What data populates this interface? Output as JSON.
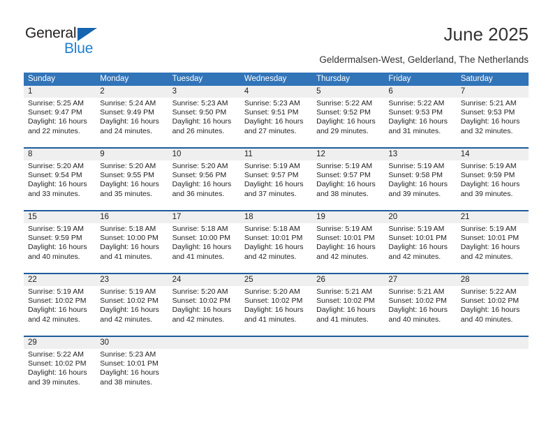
{
  "brand": {
    "name_top": "General",
    "name_bottom": "Blue",
    "triangle_color": "#1565b0",
    "blue_color": "#1f7fd4"
  },
  "header": {
    "title": "June 2025",
    "subtitle": "Geldermalsen-West, Gelderland, The Netherlands"
  },
  "colors": {
    "header_row_bg": "#3174b8",
    "week_divider": "#1d5c9e",
    "daynum_band_bg": "#efefef",
    "text": "#222222"
  },
  "calendar": {
    "weekday_headers": [
      "Sunday",
      "Monday",
      "Tuesday",
      "Wednesday",
      "Thursday",
      "Friday",
      "Saturday"
    ],
    "weeks": [
      {
        "days": [
          {
            "num": "1",
            "sunrise": "Sunrise: 5:25 AM",
            "sunset": "Sunset: 9:47 PM",
            "daylight_1": "Daylight: 16 hours",
            "daylight_2": "and 22 minutes."
          },
          {
            "num": "2",
            "sunrise": "Sunrise: 5:24 AM",
            "sunset": "Sunset: 9:49 PM",
            "daylight_1": "Daylight: 16 hours",
            "daylight_2": "and 24 minutes."
          },
          {
            "num": "3",
            "sunrise": "Sunrise: 5:23 AM",
            "sunset": "Sunset: 9:50 PM",
            "daylight_1": "Daylight: 16 hours",
            "daylight_2": "and 26 minutes."
          },
          {
            "num": "4",
            "sunrise": "Sunrise: 5:23 AM",
            "sunset": "Sunset: 9:51 PM",
            "daylight_1": "Daylight: 16 hours",
            "daylight_2": "and 27 minutes."
          },
          {
            "num": "5",
            "sunrise": "Sunrise: 5:22 AM",
            "sunset": "Sunset: 9:52 PM",
            "daylight_1": "Daylight: 16 hours",
            "daylight_2": "and 29 minutes."
          },
          {
            "num": "6",
            "sunrise": "Sunrise: 5:22 AM",
            "sunset": "Sunset: 9:53 PM",
            "daylight_1": "Daylight: 16 hours",
            "daylight_2": "and 31 minutes."
          },
          {
            "num": "7",
            "sunrise": "Sunrise: 5:21 AM",
            "sunset": "Sunset: 9:53 PM",
            "daylight_1": "Daylight: 16 hours",
            "daylight_2": "and 32 minutes."
          }
        ]
      },
      {
        "days": [
          {
            "num": "8",
            "sunrise": "Sunrise: 5:20 AM",
            "sunset": "Sunset: 9:54 PM",
            "daylight_1": "Daylight: 16 hours",
            "daylight_2": "and 33 minutes."
          },
          {
            "num": "9",
            "sunrise": "Sunrise: 5:20 AM",
            "sunset": "Sunset: 9:55 PM",
            "daylight_1": "Daylight: 16 hours",
            "daylight_2": "and 35 minutes."
          },
          {
            "num": "10",
            "sunrise": "Sunrise: 5:20 AM",
            "sunset": "Sunset: 9:56 PM",
            "daylight_1": "Daylight: 16 hours",
            "daylight_2": "and 36 minutes."
          },
          {
            "num": "11",
            "sunrise": "Sunrise: 5:19 AM",
            "sunset": "Sunset: 9:57 PM",
            "daylight_1": "Daylight: 16 hours",
            "daylight_2": "and 37 minutes."
          },
          {
            "num": "12",
            "sunrise": "Sunrise: 5:19 AM",
            "sunset": "Sunset: 9:57 PM",
            "daylight_1": "Daylight: 16 hours",
            "daylight_2": "and 38 minutes."
          },
          {
            "num": "13",
            "sunrise": "Sunrise: 5:19 AM",
            "sunset": "Sunset: 9:58 PM",
            "daylight_1": "Daylight: 16 hours",
            "daylight_2": "and 39 minutes."
          },
          {
            "num": "14",
            "sunrise": "Sunrise: 5:19 AM",
            "sunset": "Sunset: 9:59 PM",
            "daylight_1": "Daylight: 16 hours",
            "daylight_2": "and 39 minutes."
          }
        ]
      },
      {
        "days": [
          {
            "num": "15",
            "sunrise": "Sunrise: 5:19 AM",
            "sunset": "Sunset: 9:59 PM",
            "daylight_1": "Daylight: 16 hours",
            "daylight_2": "and 40 minutes."
          },
          {
            "num": "16",
            "sunrise": "Sunrise: 5:18 AM",
            "sunset": "Sunset: 10:00 PM",
            "daylight_1": "Daylight: 16 hours",
            "daylight_2": "and 41 minutes."
          },
          {
            "num": "17",
            "sunrise": "Sunrise: 5:18 AM",
            "sunset": "Sunset: 10:00 PM",
            "daylight_1": "Daylight: 16 hours",
            "daylight_2": "and 41 minutes."
          },
          {
            "num": "18",
            "sunrise": "Sunrise: 5:18 AM",
            "sunset": "Sunset: 10:01 PM",
            "daylight_1": "Daylight: 16 hours",
            "daylight_2": "and 42 minutes."
          },
          {
            "num": "19",
            "sunrise": "Sunrise: 5:19 AM",
            "sunset": "Sunset: 10:01 PM",
            "daylight_1": "Daylight: 16 hours",
            "daylight_2": "and 42 minutes."
          },
          {
            "num": "20",
            "sunrise": "Sunrise: 5:19 AM",
            "sunset": "Sunset: 10:01 PM",
            "daylight_1": "Daylight: 16 hours",
            "daylight_2": "and 42 minutes."
          },
          {
            "num": "21",
            "sunrise": "Sunrise: 5:19 AM",
            "sunset": "Sunset: 10:01 PM",
            "daylight_1": "Daylight: 16 hours",
            "daylight_2": "and 42 minutes."
          }
        ]
      },
      {
        "days": [
          {
            "num": "22",
            "sunrise": "Sunrise: 5:19 AM",
            "sunset": "Sunset: 10:02 PM",
            "daylight_1": "Daylight: 16 hours",
            "daylight_2": "and 42 minutes."
          },
          {
            "num": "23",
            "sunrise": "Sunrise: 5:19 AM",
            "sunset": "Sunset: 10:02 PM",
            "daylight_1": "Daylight: 16 hours",
            "daylight_2": "and 42 minutes."
          },
          {
            "num": "24",
            "sunrise": "Sunrise: 5:20 AM",
            "sunset": "Sunset: 10:02 PM",
            "daylight_1": "Daylight: 16 hours",
            "daylight_2": "and 42 minutes."
          },
          {
            "num": "25",
            "sunrise": "Sunrise: 5:20 AM",
            "sunset": "Sunset: 10:02 PM",
            "daylight_1": "Daylight: 16 hours",
            "daylight_2": "and 41 minutes."
          },
          {
            "num": "26",
            "sunrise": "Sunrise: 5:21 AM",
            "sunset": "Sunset: 10:02 PM",
            "daylight_1": "Daylight: 16 hours",
            "daylight_2": "and 41 minutes."
          },
          {
            "num": "27",
            "sunrise": "Sunrise: 5:21 AM",
            "sunset": "Sunset: 10:02 PM",
            "daylight_1": "Daylight: 16 hours",
            "daylight_2": "and 40 minutes."
          },
          {
            "num": "28",
            "sunrise": "Sunrise: 5:22 AM",
            "sunset": "Sunset: 10:02 PM",
            "daylight_1": "Daylight: 16 hours",
            "daylight_2": "and 40 minutes."
          }
        ]
      },
      {
        "days": [
          {
            "num": "29",
            "sunrise": "Sunrise: 5:22 AM",
            "sunset": "Sunset: 10:02 PM",
            "daylight_1": "Daylight: 16 hours",
            "daylight_2": "and 39 minutes."
          },
          {
            "num": "30",
            "sunrise": "Sunrise: 5:23 AM",
            "sunset": "Sunset: 10:01 PM",
            "daylight_1": "Daylight: 16 hours",
            "daylight_2": "and 38 minutes."
          },
          {
            "num": "",
            "sunrise": "",
            "sunset": "",
            "daylight_1": "",
            "daylight_2": ""
          },
          {
            "num": "",
            "sunrise": "",
            "sunset": "",
            "daylight_1": "",
            "daylight_2": ""
          },
          {
            "num": "",
            "sunrise": "",
            "sunset": "",
            "daylight_1": "",
            "daylight_2": ""
          },
          {
            "num": "",
            "sunrise": "",
            "sunset": "",
            "daylight_1": "",
            "daylight_2": ""
          },
          {
            "num": "",
            "sunrise": "",
            "sunset": "",
            "daylight_1": "",
            "daylight_2": ""
          }
        ]
      }
    ]
  }
}
